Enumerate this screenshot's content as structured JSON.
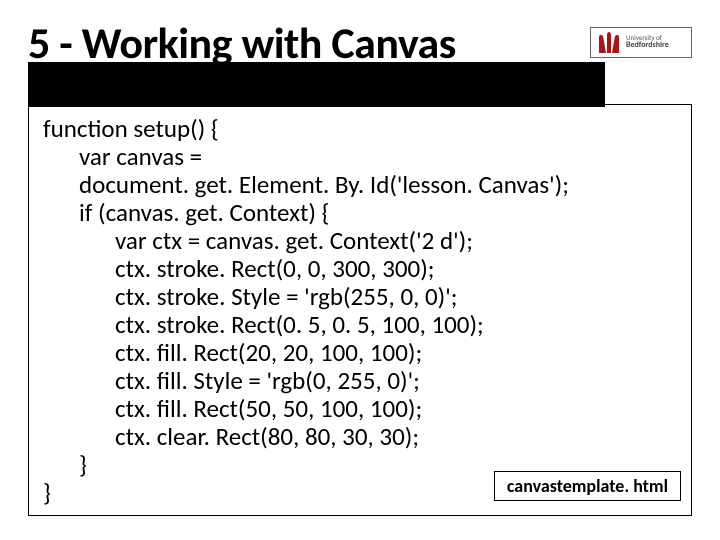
{
  "title": "5 - Working with Canvas",
  "logo": {
    "line1": "University of",
    "line2": "Bedfordshire"
  },
  "code": {
    "l0": "function setup() {",
    "l1": "var canvas =",
    "l2": "document. get. Element. By. Id('lesson. Canvas');",
    "l3": "if (canvas. get. Context) {",
    "l4": "var ctx = canvas. get. Context('2 d');",
    "l5": "ctx. stroke. Rect(0, 0, 300, 300);",
    "l6": "ctx. stroke. Style = 'rgb(255, 0, 0)';",
    "l7": "ctx. stroke. Rect(0. 5, 0. 5, 100, 100);",
    "l8": "ctx. fill. Rect(20, 20, 100, 100);",
    "l9": "ctx. fill. Style = 'rgb(0, 255, 0)';",
    "l10": "ctx. fill. Rect(50, 50, 100, 100);",
    "l11": "ctx. clear. Rect(80, 80, 30, 30);",
    "l12": "}",
    "l13": "}"
  },
  "caption": "canvastemplate. html"
}
